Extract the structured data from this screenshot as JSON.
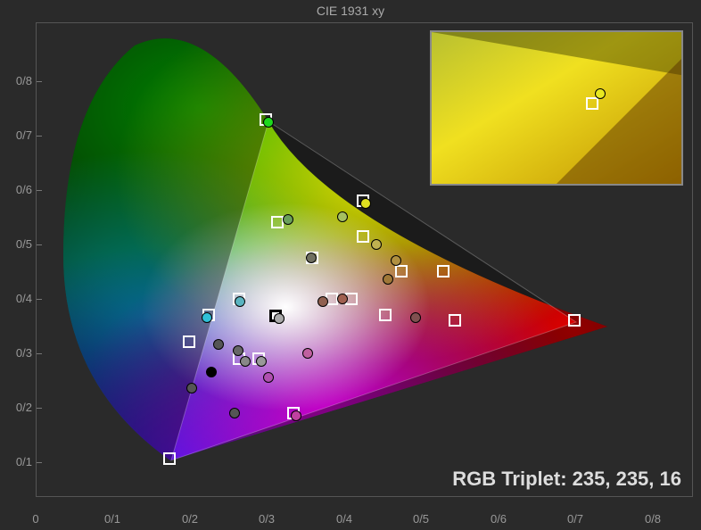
{
  "chart_data": {
    "type": "scatter",
    "title": "CIE 1931 xy",
    "xlabel": "",
    "ylabel": "",
    "xlim": [
      0,
      0.85
    ],
    "ylim": [
      0,
      0.87
    ],
    "x_ticks": [
      "0",
      "0/1",
      "0/2",
      "0/3",
      "0/4",
      "0/5",
      "0/6",
      "0/7",
      "0/8"
    ],
    "y_ticks": [
      "0/1",
      "0/2",
      "0/3",
      "0/4",
      "0/5",
      "0/6",
      "0/7",
      "0/8"
    ],
    "target_squares": [
      {
        "x": 0.175,
        "y": 0.065
      },
      {
        "x": 0.3,
        "y": 0.69
      },
      {
        "x": 0.425,
        "y": 0.54
      },
      {
        "x": 0.7,
        "y": 0.32
      },
      {
        "x": 0.3127,
        "y": 0.329
      },
      {
        "x": 0.315,
        "y": 0.5
      },
      {
        "x": 0.36,
        "y": 0.435
      },
      {
        "x": 0.2,
        "y": 0.28
      },
      {
        "x": 0.225,
        "y": 0.33
      },
      {
        "x": 0.265,
        "y": 0.25
      },
      {
        "x": 0.29,
        "y": 0.25
      },
      {
        "x": 0.265,
        "y": 0.36
      },
      {
        "x": 0.335,
        "y": 0.15
      },
      {
        "x": 0.385,
        "y": 0.36
      },
      {
        "x": 0.41,
        "y": 0.36
      },
      {
        "x": 0.425,
        "y": 0.475
      },
      {
        "x": 0.455,
        "y": 0.33
      },
      {
        "x": 0.475,
        "y": 0.41
      },
      {
        "x": 0.53,
        "y": 0.41
      },
      {
        "x": 0.545,
        "y": 0.32
      }
    ],
    "measured_points": [
      {
        "x": 0.3,
        "y": 0.69,
        "color": "#1dd81d"
      },
      {
        "x": 0.425,
        "y": 0.54,
        "color": "#e0e020"
      },
      {
        "x": 0.325,
        "y": 0.51,
        "color": "#6aa05a"
      },
      {
        "x": 0.395,
        "y": 0.515,
        "color": "#a5c060"
      },
      {
        "x": 0.355,
        "y": 0.44,
        "color": "#707060"
      },
      {
        "x": 0.262,
        "y": 0.36,
        "color": "#5ab4c0"
      },
      {
        "x": 0.22,
        "y": 0.33,
        "color": "#30c0d8"
      },
      {
        "x": 0.313,
        "y": 0.329,
        "color": "#888"
      },
      {
        "x": 0.313,
        "y": 0.329,
        "color": "#aaa"
      },
      {
        "x": 0.235,
        "y": 0.28,
        "color": "#555"
      },
      {
        "x": 0.26,
        "y": 0.27,
        "color": "#666"
      },
      {
        "x": 0.27,
        "y": 0.25,
        "color": "#888"
      },
      {
        "x": 0.29,
        "y": 0.25,
        "color": "#999"
      },
      {
        "x": 0.3,
        "y": 0.22,
        "color": "#b050b0"
      },
      {
        "x": 0.35,
        "y": 0.265,
        "color": "#c060a0"
      },
      {
        "x": 0.37,
        "y": 0.36,
        "color": "#906050"
      },
      {
        "x": 0.395,
        "y": 0.365,
        "color": "#a06050"
      },
      {
        "x": 0.44,
        "y": 0.465,
        "color": "#c0b050"
      },
      {
        "x": 0.465,
        "y": 0.435,
        "color": "#b09040"
      },
      {
        "x": 0.455,
        "y": 0.4,
        "color": "#a07838"
      },
      {
        "x": 0.49,
        "y": 0.33,
        "color": "#805050"
      },
      {
        "x": 0.225,
        "y": 0.23,
        "color": "#000"
      },
      {
        "x": 0.2,
        "y": 0.2,
        "color": "#555"
      },
      {
        "x": 0.255,
        "y": 0.155,
        "color": "#555"
      },
      {
        "x": 0.335,
        "y": 0.15,
        "color": "#c040a0"
      }
    ],
    "zoom_inset": {
      "center_square": {
        "relx": 0.65,
        "rely": 0.48
      },
      "center_point": {
        "relx": 0.67,
        "rely": 0.4,
        "color": "#e8e820"
      }
    }
  },
  "footer": {
    "rgb_label_prefix": "RGB Triplet: ",
    "rgb_value": "235, 235, 16"
  }
}
